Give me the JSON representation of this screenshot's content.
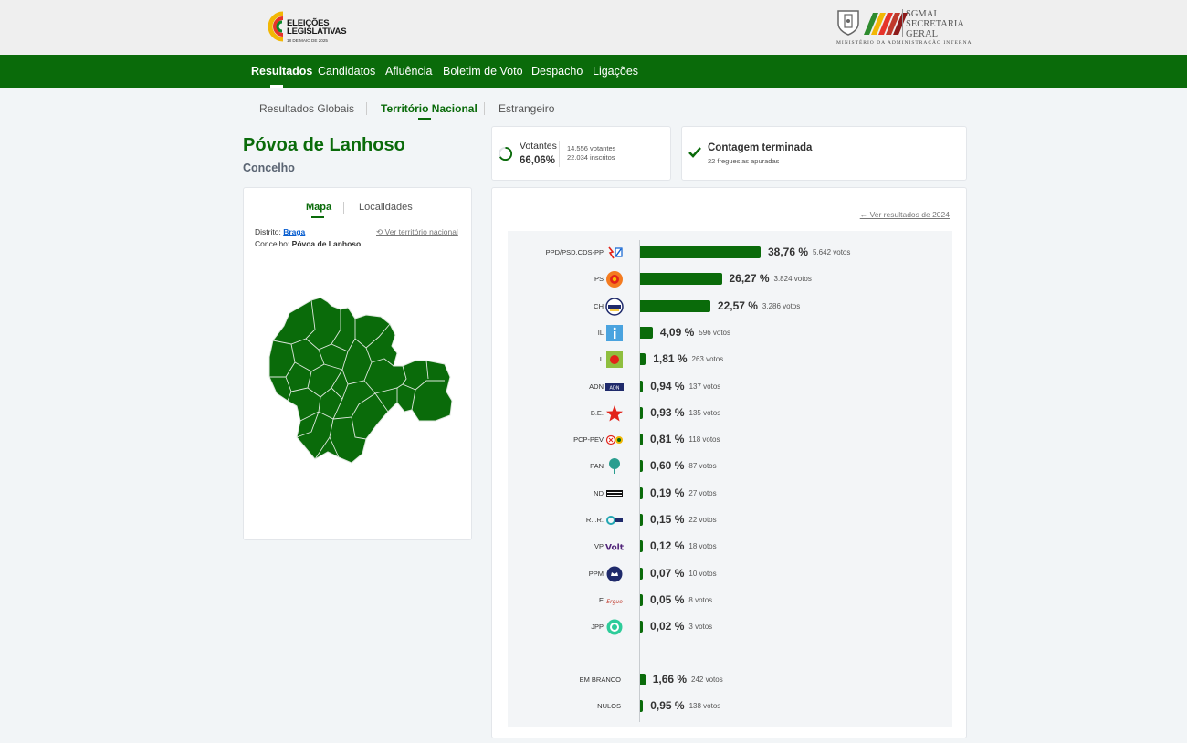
{
  "header": {
    "logo": {
      "line1": "ELEIÇÕES",
      "line2": "LEGISLATIVAS",
      "date": "18 DE MAIO DE 2025"
    },
    "sgmai": {
      "l1": "SGMAI",
      "l2": "SECRETARIA",
      "l3": "GERAL",
      "ministry": "MINISTÉRIO DA ADMINISTRAÇÃO INTERNA"
    }
  },
  "nav": [
    "Resultados",
    "Candidatos",
    "Afluência",
    "Boletim de Voto",
    "Despacho",
    "Ligações"
  ],
  "subtabs": [
    "Resultados Globais",
    "Território Nacional",
    "Estrangeiro"
  ],
  "page": {
    "title": "Póvoa de Lanhoso",
    "subtitle": "Concelho"
  },
  "votantes": {
    "label": "Votantes",
    "pct": "66,06%",
    "votantes": "14.556 votantes",
    "inscritos": "22.034 inscritos",
    "progress": 0.6606
  },
  "contagem": {
    "title": "Contagem terminada",
    "sub": "22 freguesias apuradas"
  },
  "map_card": {
    "tabs": [
      "Mapa",
      "Localidades"
    ],
    "distrito_label": "Distrito:",
    "distrito_value": "Braga",
    "concelho_label": "Concelho:",
    "concelho_value": "Póvoa de Lanhoso",
    "ver_nacional": "Ver território nacional"
  },
  "results": {
    "ver_2024": "← Ver resultados de 2024",
    "parties": [
      {
        "name": "PPD/PSD.CDS-PP",
        "pct": "38,76 %",
        "votes": "5.642 votos",
        "value": 38.76,
        "icon": "psd-cds-icon"
      },
      {
        "name": "PS",
        "pct": "26,27 %",
        "votes": "3.824 votos",
        "value": 26.27,
        "icon": "ps-icon"
      },
      {
        "name": "CH",
        "pct": "22,57 %",
        "votes": "3.286 votos",
        "value": 22.57,
        "icon": "chega-icon"
      },
      {
        "name": "IL",
        "pct": "4,09 %",
        "votes": "596 votos",
        "value": 4.09,
        "icon": "il-icon"
      },
      {
        "name": "L",
        "pct": "1,81 %",
        "votes": "263 votos",
        "value": 1.81,
        "icon": "livre-icon"
      },
      {
        "name": "ADN",
        "pct": "0,94 %",
        "votes": "137 votos",
        "value": 0.94,
        "icon": "adn-icon"
      },
      {
        "name": "B.E.",
        "pct": "0,93 %",
        "votes": "135 votos",
        "value": 0.93,
        "icon": "be-star-icon"
      },
      {
        "name": "PCP-PEV",
        "pct": "0,81 %",
        "votes": "118 votos",
        "value": 0.81,
        "icon": "cdu-icon"
      },
      {
        "name": "PAN",
        "pct": "0,60 %",
        "votes": "87 votos",
        "value": 0.6,
        "icon": "pan-tree-icon"
      },
      {
        "name": "ND",
        "pct": "0,19 %",
        "votes": "27 votos",
        "value": 0.19,
        "icon": "nd-icon"
      },
      {
        "name": "R.I.R.",
        "pct": "0,15 %",
        "votes": "22 votos",
        "value": 0.15,
        "icon": "rir-icon"
      },
      {
        "name": "VP",
        "pct": "0,12 %",
        "votes": "18 votos",
        "value": 0.12,
        "icon": "volt-icon"
      },
      {
        "name": "PPM",
        "pct": "0,07 %",
        "votes": "10 votos",
        "value": 0.07,
        "icon": "ppm-icon"
      },
      {
        "name": "E",
        "pct": "0,05 %",
        "votes": "8 votos",
        "value": 0.05,
        "icon": "ergue-te-icon"
      },
      {
        "name": "JPP",
        "pct": "0,02 %",
        "votes": "3 votos",
        "value": 0.02,
        "icon": "jpp-icon"
      }
    ],
    "others": [
      {
        "name": "EM BRANCO",
        "pct": "1,66 %",
        "votes": "242 votos",
        "value": 1.66
      },
      {
        "name": "NULOS",
        "pct": "0,95 %",
        "votes": "138 votos",
        "value": 0.95
      }
    ]
  },
  "colors": {
    "brand_green": "#0a6b0a",
    "link_blue": "#0a5fd0"
  }
}
